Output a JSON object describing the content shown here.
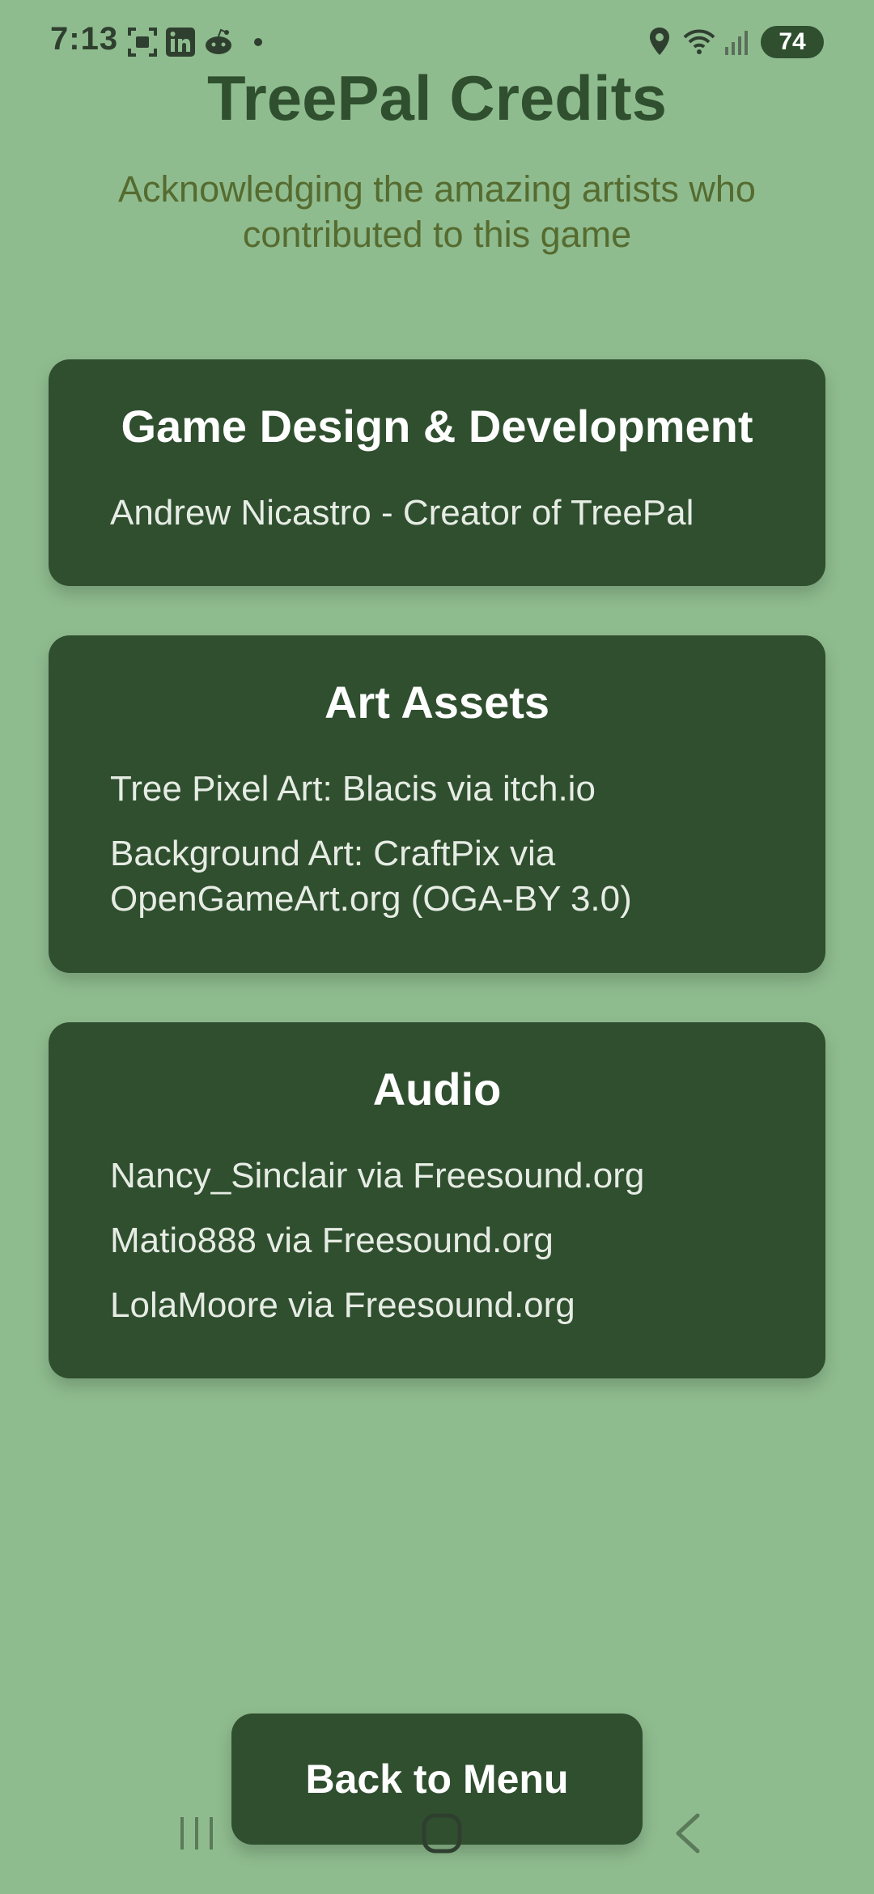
{
  "status_bar": {
    "time": "7:13",
    "battery": "74",
    "icons": [
      "screenshot-icon",
      "linkedin-icon",
      "reddit-icon",
      "dot-icon",
      "location-icon",
      "wifi-icon",
      "signal-icon",
      "battery-icon"
    ]
  },
  "header": {
    "title": "TreePal Credits",
    "subtitle": "Acknowledging the amazing artists who contributed to this game"
  },
  "sections": {
    "design": {
      "heading": "Game Design & Development",
      "items": [
        "Andrew Nicastro - Creator of TreePal"
      ]
    },
    "art": {
      "heading": "Art Assets",
      "items": [
        "Tree Pixel Art: Blacis via itch.io",
        "Background Art: CraftPix via OpenGameArt.org (OGA-BY 3.0)"
      ]
    },
    "audio": {
      "heading": "Audio",
      "items": [
        "Nancy_Sinclair via Freesound.org",
        "Matio888 via Freesound.org",
        "LolaMoore via Freesound.org"
      ]
    }
  },
  "back_button": {
    "label": "Back to Menu"
  },
  "colors": {
    "background": "#8fbc8f",
    "card": "#2f4f2f",
    "title": "#2f4f2f",
    "subtitle": "#556b2f"
  }
}
